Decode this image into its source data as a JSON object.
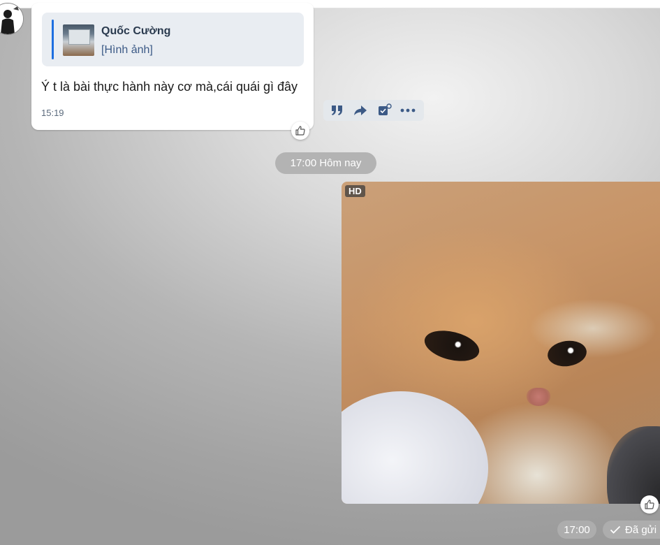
{
  "quoted_message": {
    "sender_name": "Quốc Cường",
    "content": "[Hình ảnh]"
  },
  "received_message": {
    "text": "Ý t là bài thực hành này cơ mà,cái quái gì đây",
    "time": "15:19"
  },
  "message_actions": {
    "icons": [
      "quote-icon",
      "forward-icon",
      "create-task-icon",
      "more-icon"
    ]
  },
  "date_separator": "17:00 Hôm nay",
  "sent_image": {
    "badge": "HD",
    "time": "17:00",
    "status": "Đã gửi"
  },
  "colors": {
    "accent": "#1e6fe0",
    "bubble": "#ffffff",
    "pill": "#b3b3b3",
    "action_icon": "#3c5a86"
  }
}
